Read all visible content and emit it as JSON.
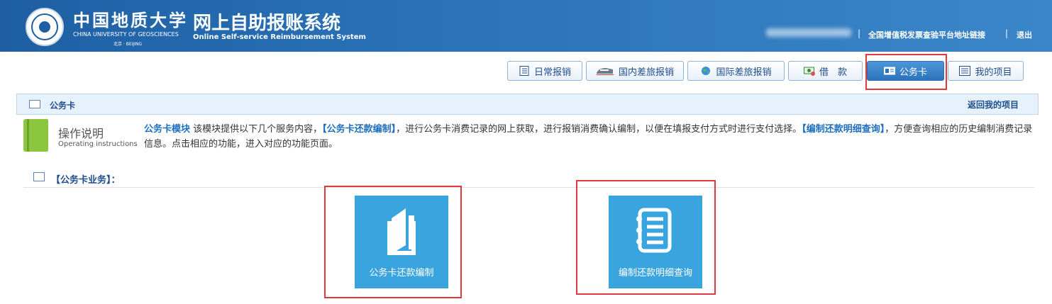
{
  "header": {
    "university_cn": "中国地质大学",
    "university_en": "CHINA UNIVERSITY OF GEOSCIENCES",
    "university_city": "北京 · BEIJING",
    "system_cn": "网上自助报账系统",
    "system_en": "Online Self-service Reimbursement System",
    "links": {
      "invoice_check": "全国增值税发票查验平台地址链接",
      "logout": "退出"
    }
  },
  "tabs": [
    {
      "label": "日常报销",
      "icon": "notebook-icon"
    },
    {
      "label": "国内差旅报销",
      "icon": "train-icon"
    },
    {
      "label": "国际差旅报销",
      "icon": "globe-icon"
    },
    {
      "label": "借　款",
      "icon": "money-icon"
    },
    {
      "label": "公务卡",
      "icon": "card-icon",
      "active": true
    },
    {
      "label": "我的项目",
      "icon": "list-icon"
    }
  ],
  "section": {
    "title": "公务卡",
    "back_link": "返回我的项目"
  },
  "instructions": {
    "title_cn": "操作说明",
    "title_en": "Operating instructions",
    "p1": "公务卡模块",
    "p2": " 该模块提供以下几个服务内容，",
    "p3": "【公务卡还款编制】",
    "p4": "，进行公务卡消费记录的网上获取，进行报销消费确认编制，以便在填报支付方式时进行支付选择。",
    "p5": "【编制还款明细查询】",
    "p6": "，方便查询相应的历史编制消费记录信息。点击相应的功能，进入对应的功能页面。"
  },
  "business": {
    "title": "【公务卡业务】：",
    "tiles": [
      {
        "label": "公务卡还款编制",
        "icon": "book-icon"
      },
      {
        "label": "编制还款明细查询",
        "icon": "notepad-icon"
      }
    ]
  },
  "colors": {
    "header": "#2a72b8",
    "accent": "#1f4e8c",
    "tile": "#3aa4df",
    "highlight": "#e0393e",
    "book": "#8cc63e"
  }
}
